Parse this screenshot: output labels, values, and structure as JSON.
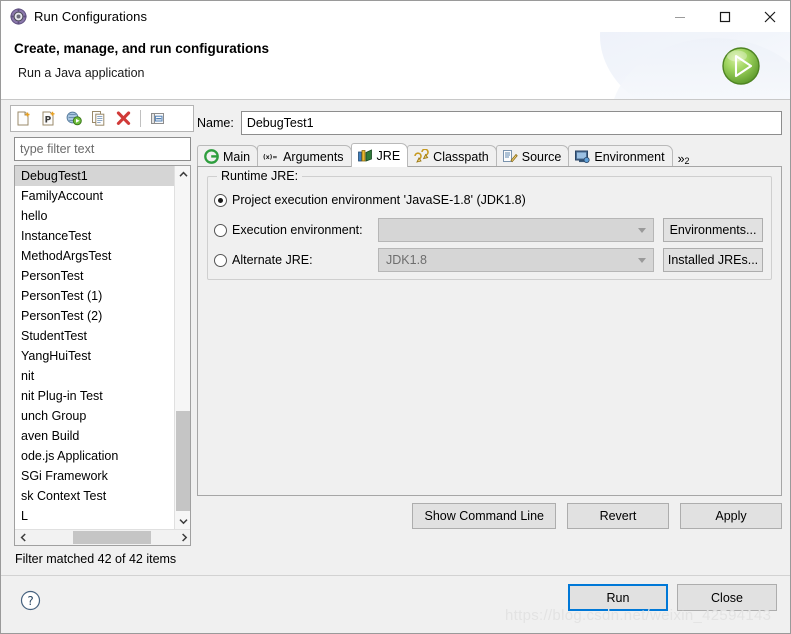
{
  "window": {
    "title": "Run Configurations",
    "icon": "run-configurations-icon",
    "minimize": "minimize-icon",
    "maximize": "maximize-icon",
    "close": "close-icon"
  },
  "banner": {
    "title": "Create, manage, and run configurations",
    "subtitle": "Run a Java application",
    "badge_icon": "run-play-icon"
  },
  "left": {
    "toolbar": [
      {
        "name": "new-launch-configuration",
        "icon": "new-config-icon"
      },
      {
        "name": "new-prototype",
        "icon": "new-prototype-icon"
      },
      {
        "name": "new-launch-group",
        "icon": "new-launch-group-icon"
      },
      {
        "name": "duplicate-configuration",
        "icon": "duplicate-icon"
      },
      {
        "name": "delete-configuration",
        "icon": "delete-x-icon"
      },
      {
        "name": "collapse-all",
        "icon": "collapse-all-icon"
      }
    ],
    "filter_placeholder": "type filter text",
    "filter_value": "",
    "items": [
      "DebugTest1",
      "FamilyAccount",
      "hello",
      "InstanceTest",
      "MethodArgsTest",
      "PersonTest",
      "PersonTest (1)",
      "PersonTest (2)",
      "StudentTest",
      "YangHuiTest",
      "nit",
      "nit Plug-in Test",
      "unch Group",
      "aven Build",
      "ode.js Application",
      "SGi Framework",
      "sk Context Test",
      "L"
    ],
    "selected_index": 0,
    "status": "Filter matched 42 of 42 items"
  },
  "right": {
    "name_label": "Name:",
    "name_value": "DebugTest1",
    "tabs": [
      {
        "label": "Main",
        "icon": "main-tab-icon",
        "active": false
      },
      {
        "label": "Arguments",
        "icon": "arguments-tab-icon",
        "active": false
      },
      {
        "label": "JRE",
        "icon": "jre-tab-icon",
        "active": true
      },
      {
        "label": "Classpath",
        "icon": "classpath-tab-icon",
        "active": false
      },
      {
        "label": "Source",
        "icon": "source-tab-icon",
        "active": false
      },
      {
        "label": "Environment",
        "icon": "environment-tab-icon",
        "active": false
      }
    ],
    "tab_overflow": "»",
    "tab_overflow_count": "2",
    "group_title": "Runtime JRE:",
    "options": [
      {
        "label": "Project execution environment 'JavaSE-1.8' (JDK1.8)",
        "selected": true
      },
      {
        "label": "Execution environment:",
        "selected": false,
        "combo_value": "",
        "button": "Environments..."
      },
      {
        "label": "Alternate JRE:",
        "selected": false,
        "combo_value": "JDK1.8",
        "button": "Installed JREs..."
      }
    ],
    "actions": {
      "show_command_line": "Show Command Line",
      "revert": "Revert",
      "apply": "Apply"
    }
  },
  "footer": {
    "help_icon": "help-question-icon",
    "run": "Run",
    "close": "Close",
    "watermark": "https://blog.csdn.net/weixin_42594143"
  },
  "colors": {
    "accent": "#0078d7",
    "selection": "#d5d5d5",
    "dialog_bg": "#f0f0f0",
    "run_green": "#66b032",
    "delete_red": "#d13a38"
  }
}
